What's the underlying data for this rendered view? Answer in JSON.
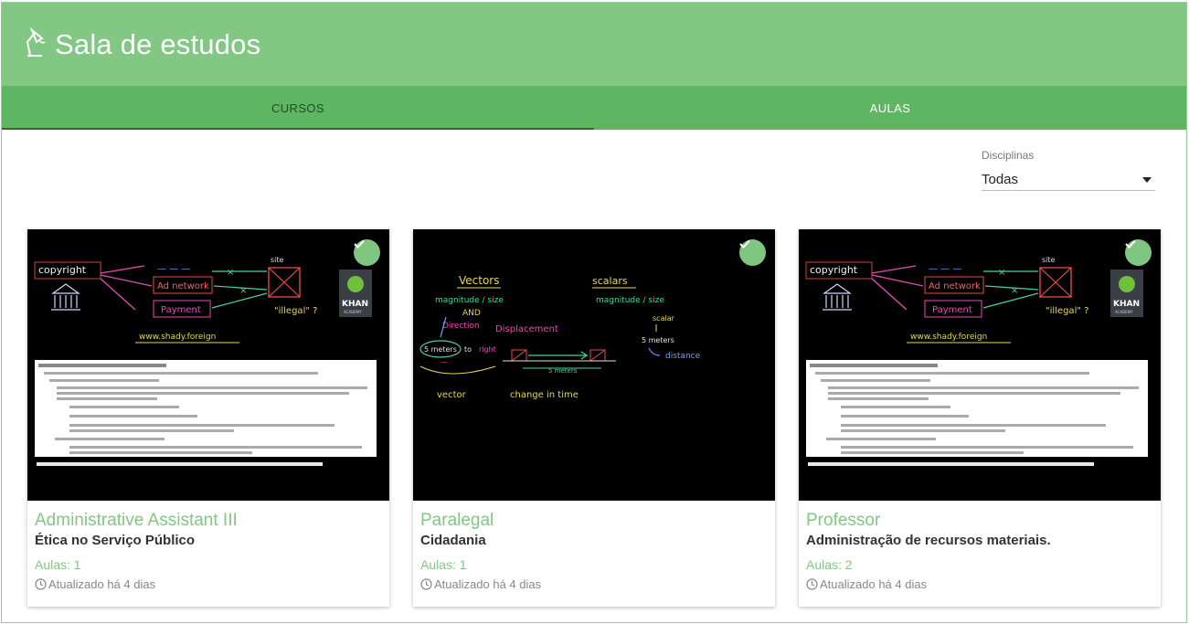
{
  "header": {
    "title": "Sala de estudos",
    "icon": "lamp-icon"
  },
  "tabs": [
    {
      "label": "CURSOS",
      "active": true
    },
    {
      "label": "AULAS",
      "active": false
    }
  ],
  "filter": {
    "label": "Disciplinas",
    "value": "Todas"
  },
  "cards": [
    {
      "name": "Administrative Assistant III",
      "subject": "Ética no Serviço Público",
      "lessons": "Aulas: 1",
      "updated": "Atualizado há 4 dias",
      "completed": true,
      "thumbnail": "copyright",
      "thumb_text": [
        "copyright",
        "Ad network",
        "Payment",
        "www.shady.foreign",
        "site",
        "\"illegal\" ?",
        "KHAN",
        "ACADEMY"
      ]
    },
    {
      "name": "Paralegal",
      "subject": "Cidadania",
      "lessons": "Aulas: 1",
      "updated": "Atualizado há 4 dias",
      "completed": true,
      "thumbnail": "vectors",
      "thumb_text": [
        "Vectors",
        "scalars",
        "magnitude / size",
        "magnitude / size",
        "AND",
        "Direction",
        "Displacement",
        "scalar",
        "5 meters",
        "5 meters",
        "distance",
        "right",
        "5 meters",
        "vector",
        "change in time"
      ]
    },
    {
      "name": "Professor",
      "subject": "Administração de recursos materiais.",
      "lessons": "Aulas: 2",
      "updated": "Atualizado há 4 dias",
      "completed": true,
      "thumbnail": "copyright",
      "thumb_text": [
        "copyright",
        "Ad network",
        "Payment",
        "www.shady.foreign",
        "site",
        "\"illegal\" ?",
        "KHAN",
        "ACADEMY"
      ]
    }
  ],
  "colors": {
    "header": "#82c784",
    "tabs": "#5eb663",
    "accent": "#82c784",
    "active_tab_text": "#1f4d22"
  }
}
